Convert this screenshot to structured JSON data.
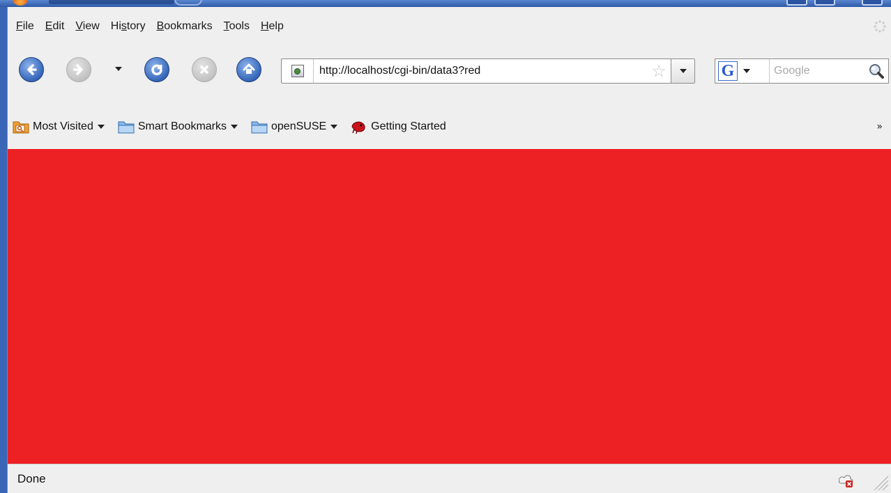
{
  "menubar": {
    "items": [
      {
        "pre": "",
        "key": "F",
        "post": "ile"
      },
      {
        "pre": "",
        "key": "E",
        "post": "dit"
      },
      {
        "pre": "",
        "key": "V",
        "post": "iew"
      },
      {
        "pre": "Hi",
        "key": "s",
        "post": "tory"
      },
      {
        "pre": "",
        "key": "B",
        "post": "ookmarks"
      },
      {
        "pre": "",
        "key": "T",
        "post": "ools"
      },
      {
        "pre": "",
        "key": "H",
        "post": "elp"
      }
    ]
  },
  "navigation": {
    "url": "http://localhost/cgi-bin/data3?red",
    "search_placeholder": "Google",
    "search_engine_letter": "G"
  },
  "bookmarks": {
    "items": [
      {
        "label": "Most Visited",
        "icon": "folder-smart-icon",
        "dropdown": true
      },
      {
        "label": "Smart Bookmarks",
        "icon": "folder-icon",
        "dropdown": true
      },
      {
        "label": "openSUSE",
        "icon": "folder-icon",
        "dropdown": true
      },
      {
        "label": "Getting Started",
        "icon": "chameleon-icon",
        "dropdown": false
      }
    ],
    "overflow": "»"
  },
  "content": {
    "background_color": "#ed2024"
  },
  "statusbar": {
    "text": "Done"
  }
}
